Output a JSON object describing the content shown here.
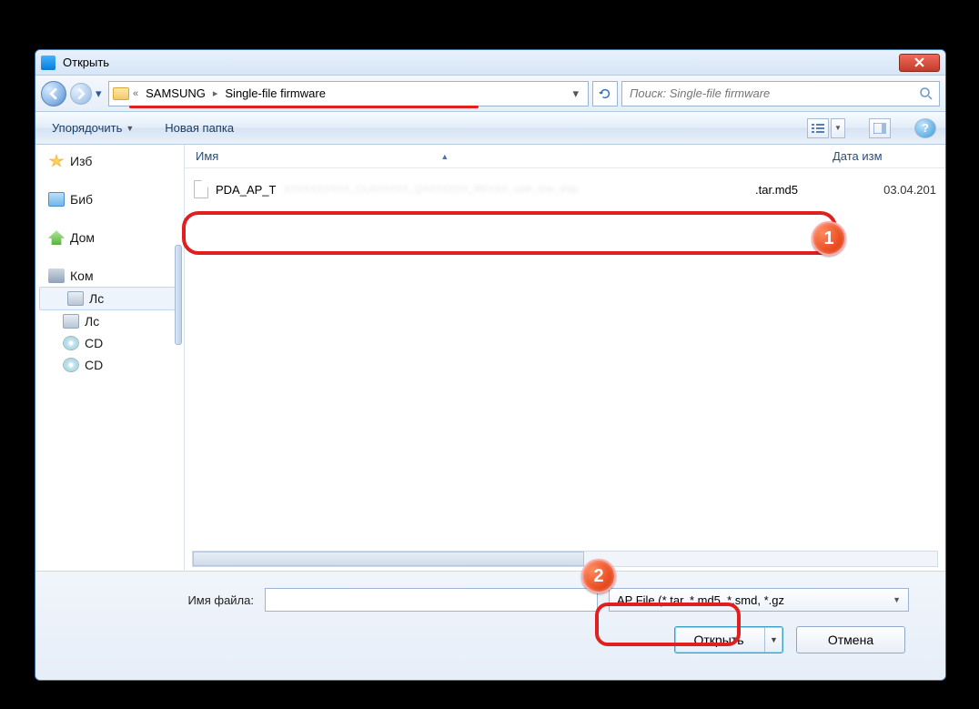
{
  "window": {
    "title": "Открыть"
  },
  "nav": {
    "path_root": "«",
    "segments": [
      "SAMSUNG",
      "Single-file firmware"
    ]
  },
  "search": {
    "placeholder": "Поиск: Single-file firmware"
  },
  "toolbar": {
    "organize": "Упорядочить",
    "newfolder": "Новая папка"
  },
  "sidebar": {
    "favorites": "Изб",
    "libraries": "Биб",
    "homegroup": "Дом",
    "computer": "Ком",
    "drives": [
      "Лс",
      "Лс",
      "CD",
      "CD"
    ]
  },
  "columns": {
    "name": "Имя",
    "date": "Дата изм"
  },
  "files": [
    {
      "name_prefix": "PDA_AP_T",
      "name_obscured": "XXXXXXXXXX_CLAXXXXX_QXXXXXXX_REVXX_user_low_ship",
      "name_ext": ".tar.md5",
      "date": "03.04.201"
    }
  ],
  "footer": {
    "filename_label": "Имя файла:",
    "filetype": "AP File (*.tar, *.md5, *.smd, *.gz",
    "open": "Открыть",
    "cancel": "Отмена"
  },
  "badges": {
    "one": "1",
    "two": "2"
  }
}
